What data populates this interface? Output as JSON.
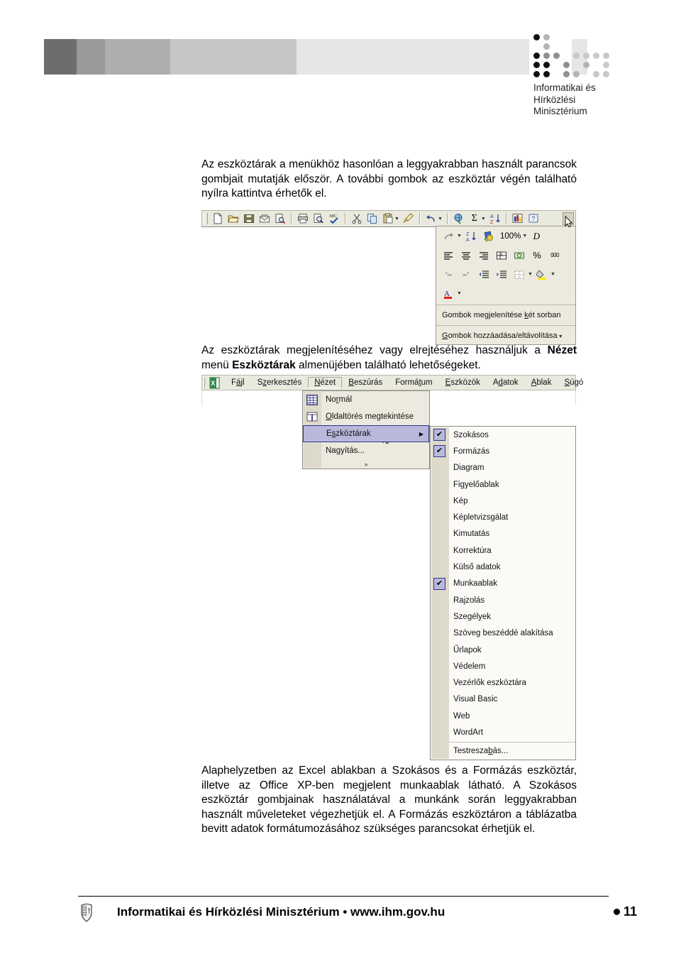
{
  "header": {
    "band_segments": [
      "#6d6d6d",
      "#9a9a9a",
      "#aeaeae",
      "#c6c6c6",
      "#e4e4e4"
    ],
    "accent_square_color": "#e4e4e4",
    "logo": {
      "name": "ihm-logo",
      "lines": [
        "Informatikai és",
        "Hírközlési",
        "Minisztérium"
      ]
    }
  },
  "paragraphs": {
    "p1_part1": "Az eszköztárak a menükhöz hasonlóan a leggyakrabban használt parancsok gombjait mutatják először. A további gombok az eszköztár végén található nyílra kattintva érhetők el.",
    "p2_a": "Az eszköztárak megjelenítéséhez vagy elrejtéséhez használjuk a ",
    "p2_b": "Nézet",
    "p2_c": " menü ",
    "p2_d": "Eszköztárak",
    "p2_e": " almenüjében található lehetőségeket.",
    "p3": "Alaphelyzetben az Excel ablakban a Szokásos és a Formázás eszköztár, illetve az Office XP-ben megjelent munkaablak látható. A Szokásos eszköztár gombjainak használatával a munkánk során leggyakrabban használt műveleteket végezhetjük el. A Formázás eszköztáron a táblázatba bevitt adatok formátumozásához szükséges parancsokat érhetjük el."
  },
  "screenshot_toolbar": {
    "name": "excel-standard-toolbar",
    "buttons": [
      {
        "name": "new-document-icon",
        "glyph": "□"
      },
      {
        "name": "open-folder-icon",
        "glyph": "📂"
      },
      {
        "name": "save-icon",
        "glyph": "💾"
      },
      {
        "name": "mail-recipient-icon",
        "glyph": "✉"
      },
      {
        "name": "search-document-icon",
        "glyph": "🔍"
      },
      {
        "name": "print-icon",
        "glyph": "🖨"
      },
      {
        "name": "print-preview-icon",
        "glyph": "🔎"
      },
      {
        "name": "spell-check-icon",
        "glyph": "ABC"
      },
      {
        "name": "cut-scissors-icon",
        "glyph": "✂"
      },
      {
        "name": "copy-icon",
        "glyph": "⧉"
      },
      {
        "name": "paste-icon",
        "glyph": "📋"
      },
      {
        "name": "format-painter-icon",
        "glyph": "🖌"
      },
      {
        "name": "undo-icon",
        "glyph": "↶"
      },
      {
        "name": "insert-hyperlink-icon",
        "glyph": "🌐"
      },
      {
        "name": "autosum-icon",
        "glyph": "Σ"
      },
      {
        "name": "sort-ascending-icon",
        "glyph": "A↓"
      },
      {
        "name": "chart-wizard-icon",
        "glyph": "📊"
      },
      {
        "name": "help-icon",
        "glyph": "?"
      }
    ],
    "overflow_button": {
      "name": "toolbar-options-chevron",
      "glyph": "»"
    },
    "panel": {
      "row1": [
        {
          "name": "redo-icon",
          "glyph": "↷"
        },
        {
          "name": "sort-descending-icon",
          "glyph": "Z↓"
        },
        {
          "name": "drawing-icon",
          "glyph": "◆"
        }
      ],
      "zoom_value": "100%",
      "row1_tail": {
        "name": "font-italic-d-icon",
        "glyph": "D"
      },
      "row2": [
        {
          "name": "align-left-icon",
          "glyph": "≡"
        },
        {
          "name": "align-center-icon",
          "glyph": "≡"
        },
        {
          "name": "align-right-icon",
          "glyph": "≡"
        },
        {
          "name": "merge-cells-icon",
          "glyph": "⊞"
        },
        {
          "name": "currency-icon",
          "glyph": "💵"
        },
        {
          "name": "percent-style-icon",
          "glyph": "%"
        },
        {
          "name": "comma-style-icon",
          "glyph": "000"
        }
      ],
      "row3": [
        {
          "name": "increase-decimal-icon",
          "glyph": "+.00"
        },
        {
          "name": "decrease-decimal-icon",
          "glyph": "-.00"
        },
        {
          "name": "decrease-indent-icon",
          "glyph": "⇤"
        },
        {
          "name": "increase-indent-icon",
          "glyph": "⇥"
        },
        {
          "name": "borders-icon",
          "glyph": "▦"
        },
        {
          "name": "fill-color-icon",
          "glyph": "🎨"
        }
      ],
      "row4": [
        {
          "name": "font-color-icon",
          "glyph": "A"
        }
      ],
      "items": [
        {
          "name": "show-buttons-two-rows-item",
          "pre": "Gombok megjelenítése ",
          "key": "k",
          "post": "ét sorban"
        },
        {
          "name": "add-remove-buttons-item",
          "pre": "",
          "key": "G",
          "post": "ombok hozzáadása/eltávolítása"
        }
      ]
    }
  },
  "screenshot_menu": {
    "name": "excel-view-menu",
    "app_icon": "excel-icon",
    "menubar": [
      {
        "name": "menu-fajl",
        "pre": "F",
        "key": "á",
        "post": "jl"
      },
      {
        "name": "menu-szerkesztes",
        "pre": "S",
        "key": "z",
        "post": "erkesztés"
      },
      {
        "name": "menu-nezet",
        "pre": "",
        "key": "N",
        "post": "ézet",
        "active": true
      },
      {
        "name": "menu-beszuras",
        "pre": "",
        "key": "B",
        "post": "eszúrás"
      },
      {
        "name": "menu-formatum",
        "pre": "Formá",
        "key": "t",
        "post": "um"
      },
      {
        "name": "menu-eszkozok",
        "pre": "",
        "key": "E",
        "post": "szközök"
      },
      {
        "name": "menu-adatok",
        "pre": "A",
        "key": "d",
        "post": "atok"
      },
      {
        "name": "menu-ablak",
        "pre": "",
        "key": "A",
        "post": "blak"
      },
      {
        "name": "menu-sugo",
        "pre": "",
        "key": "S",
        "post": "úgó"
      }
    ],
    "view_menu": [
      {
        "name": "view-item-normal",
        "pre": "No",
        "key": "r",
        "post": "mál",
        "icon": "grid-icon",
        "selected": false
      },
      {
        "name": "view-item-oldaltores",
        "pre": "",
        "key": "O",
        "post": "ldaltörés megtekintése",
        "icon": "page-break-icon",
        "selected": false
      },
      {
        "name": "view-item-eszkoztarak",
        "pre": "E",
        "key": "s",
        "post": "zköztárak",
        "icon": "",
        "selected": true,
        "submenu": true
      },
      {
        "name": "view-item-nagyitas",
        "pre": "Na",
        "key": "g",
        "post": "yítás...",
        "icon": "",
        "selected": false
      }
    ],
    "view_menu_expand": "»",
    "submenu_items": [
      {
        "name": "toolbar-item-szokasos",
        "label": "Szokásos",
        "checked": true
      },
      {
        "name": "toolbar-item-formazas",
        "label": "Formázás",
        "checked": true
      },
      {
        "name": "toolbar-item-diagram",
        "label": "Diagram",
        "checked": false
      },
      {
        "name": "toolbar-item-figyeloablak",
        "label": "Figyelőablak",
        "checked": false
      },
      {
        "name": "toolbar-item-kep",
        "label": "Kép",
        "checked": false
      },
      {
        "name": "toolbar-item-kepletvizsgalat",
        "label": "Képletvizsgálat",
        "checked": false
      },
      {
        "name": "toolbar-item-kimutatas",
        "label": "Kimutatás",
        "checked": false
      },
      {
        "name": "toolbar-item-korrektura",
        "label": "Korrektúra",
        "checked": false
      },
      {
        "name": "toolbar-item-kulso-adatok",
        "label": "Külső adatok",
        "checked": false
      },
      {
        "name": "toolbar-item-munkaablak",
        "label": "Munkaablak",
        "checked": true
      },
      {
        "name": "toolbar-item-rajzolas",
        "label": "Rajzolás",
        "checked": false
      },
      {
        "name": "toolbar-item-szegelyek",
        "label": "Szegélyek",
        "checked": false
      },
      {
        "name": "toolbar-item-szoveg-beszedde",
        "label": "Szöveg beszéddé alakítása",
        "checked": false
      },
      {
        "name": "toolbar-item-urlapok",
        "label": "Űrlapok",
        "checked": false
      },
      {
        "name": "toolbar-item-vedelem",
        "label": "Védelem",
        "checked": false
      },
      {
        "name": "toolbar-item-vezerlok",
        "label": "Vezérlők eszköztára",
        "checked": false
      },
      {
        "name": "toolbar-item-visual-basic",
        "label": "Visual Basic",
        "checked": false
      },
      {
        "name": "toolbar-item-web",
        "label": "Web",
        "checked": false
      },
      {
        "name": "toolbar-item-wordart",
        "label": "WordArt",
        "checked": false
      }
    ],
    "submenu_last": {
      "name": "toolbar-item-testreszabas",
      "pre": "Testresza",
      "key": "b",
      "post": "ás..."
    }
  },
  "footer": {
    "crest": "hungary-coat-of-arms",
    "text": "Informatikai és Hírközlési Minisztérium • www.ihm.gov.hu",
    "page_number": "11"
  }
}
